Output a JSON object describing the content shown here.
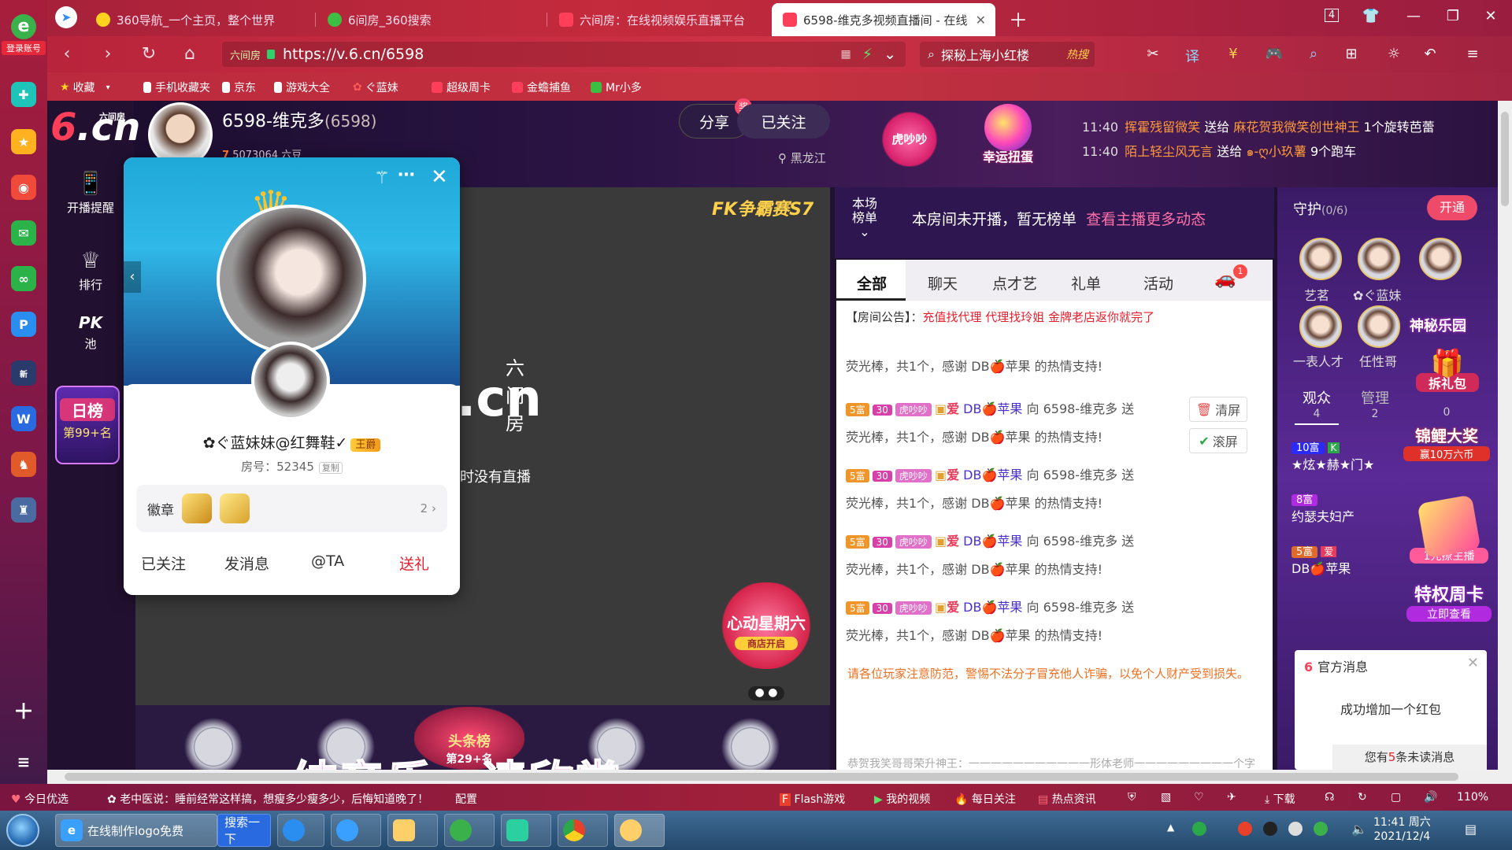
{
  "browser": {
    "login_label": "登录账号",
    "tabs": [
      {
        "label": "360导航_一个主页，整个世界",
        "icon_color": "#ffd21f"
      },
      {
        "label": "6间房_360搜索",
        "icon_color": "#3dbd42"
      },
      {
        "label": "六间房：在线视频娱乐直播平台",
        "icon_color": "#ff3f5a"
      },
      {
        "label": "6598-维克多视频直播间 - 在线",
        "icon_color": "#ff3f5a"
      }
    ],
    "tab_count": "4",
    "url": "https://v.6.cn/6598",
    "url_site": "六间房",
    "search_text": "探秘上海小红楼",
    "search_hot": "热搜",
    "bookmarks": [
      "收藏",
      "手机收藏夹",
      "京东",
      "游戏大全",
      "ぐ蓝妹",
      "超级周卡",
      "金蟾捕鱼",
      "Mr小多"
    ],
    "colors": {
      "chrome": "#c42b3c",
      "accent": "#ff3f5a"
    }
  },
  "site": {
    "logo": "6.cn",
    "logo_small": "六间房",
    "menu": [
      {
        "label": "开播提醒",
        "icon": "phone-icon"
      },
      {
        "label": "排行",
        "icon": "crown-icon"
      },
      {
        "label": "池",
        "icon": "pk-icon",
        "pk": "PK"
      }
    ],
    "daily_rank": {
      "title": "日榜",
      "place": "第99+名"
    }
  },
  "anchor": {
    "name": "6598-维克多",
    "room_id": "(6598)",
    "followers": "5073064 六豆",
    "share_label": "分享",
    "followed_label": "已关注",
    "location": "黑龙江",
    "tiger_label": "虎吵吵",
    "egg_label": "幸运扭蛋"
  },
  "marquee": [
    {
      "time": "11:40",
      "from": "挥霍残留微笑",
      "verb": "送给",
      "to": "麻花贺我微笑创世神王",
      "gift": "1个旋转芭蕾"
    },
    {
      "time": "11:40",
      "from": "陌上轻尘风无言",
      "verb": "送给",
      "to": "๑-ღ小玖薯",
      "gift": "9个跑车"
    }
  ],
  "video": {
    "brand": ".cn",
    "brand_small": "六间房",
    "not_live": "时没有直播",
    "fk_badge": "FK争霸赛S7",
    "promo": "心动星期六",
    "promo_sub": "商店开启",
    "toplist": "头条榜",
    "toplist_place": "第29+名",
    "caption": "纯音乐，请欣赏"
  },
  "popup": {
    "name": "✿ぐ蓝妹妹@红舞鞋✓",
    "level": "王爵",
    "room_label": "房号：52345",
    "copy_label": "复制",
    "badges_label": "徽章",
    "badges_count": "2",
    "actions": [
      "已关注",
      "发消息",
      "@TA",
      "送礼"
    ]
  },
  "rank": {
    "label_line1": "本场",
    "label_line2": "榜单",
    "message": "本房间未开播，暂无榜单",
    "link": "查看主播更多动态"
  },
  "chat": {
    "tabs": [
      "全部",
      "聊天",
      "点才艺",
      "礼单",
      "活动"
    ],
    "car_badge": "1",
    "notice_label": "【房间公告】：",
    "notice_text": "充值找代理 代理找玲姐 金牌老店返你就完了",
    "clear_label": "清屏",
    "scroll_label": "滚屏",
    "rows": [
      {
        "rank": "5富",
        "level": "30",
        "tag": "虎吵吵",
        "user": "DB🍎苹果",
        "action": "向 6598-维克多 送",
        "thanks": "荧光棒，共1个，感谢 DB🍎苹果 的热情支持!"
      },
      {
        "rank": "5富",
        "level": "30",
        "tag": "虎吵吵",
        "user": "DB🍎苹果",
        "action": "向 6598-维克多 送",
        "thanks": "荧光棒，共1个，感谢 DB🍎苹果 的热情支持!"
      },
      {
        "rank": "5富",
        "level": "30",
        "tag": "虎吵吵",
        "user": "DB🍎苹果",
        "action": "向 6598-维克多 送",
        "thanks": "荧光棒，共1个，感谢 DB🍎苹果 的热情支持!"
      },
      {
        "rank": "5富",
        "level": "30",
        "tag": "虎吵吵",
        "user": "DB🍎苹果",
        "action": "向 6598-维克多 送",
        "thanks": "荧光棒，共1个，感谢 DB🍎苹果 的热情支持!"
      }
    ],
    "first_thanks": "荧光棒，共1个，感谢 DB🍎苹果 的热情支持!",
    "warning": "请各位玩家注意防范，警惕不法分子冒充他人诈骗，以免个人财产受到损失。",
    "footer": "恭贺我笑哥哥荣升神王：一一一一一一一一一一一形体老师一一一一一一一一一个字"
  },
  "guard": {
    "title": "守护",
    "count": "(0/6)",
    "open_label": "开通",
    "members": [
      "艺茗",
      "✿ぐ蓝妹",
      "一表人才",
      "任性哥"
    ],
    "mystery": "神秘乐园",
    "gift_pack": "拆礼包",
    "tabs": [
      {
        "label": "观众",
        "n": "4"
      },
      {
        "label": "管理",
        "n": "2"
      }
    ],
    "zero": "0",
    "viewers": [
      {
        "rank": "10富",
        "name": "★炫★赫★门★"
      },
      {
        "rank": "8富",
        "name": "约瑟夫妇产"
      },
      {
        "rank": "5富",
        "name": "DB🍎苹果"
      }
    ],
    "promo1": "锦鲤大奖",
    "promo1b": "赢10万六币",
    "promo2": "1元撩主播",
    "promo3": "特权周卡",
    "promo3b": "立即查看",
    "official_title": "官方消息",
    "official_body": "成功增加一个红包",
    "official_unread_pre": "您有",
    "official_unread_num": "5",
    "official_unread_post": "条未读消息"
  },
  "statusbar": {
    "items": [
      "今日优选",
      "老中医说：睡前经常这样搞，想瘦多少瘦多少，后悔知道晚了！",
      "Flash游戏",
      "我的视频",
      "每日关注",
      "热点资讯",
      "下载"
    ],
    "zoom": "110%",
    "closing": "配置"
  },
  "taskbar": {
    "ie_label": "在线制作logo免费",
    "search_btn": "搜索一下",
    "time": "11:41 周六",
    "date": "2021/12/4"
  }
}
